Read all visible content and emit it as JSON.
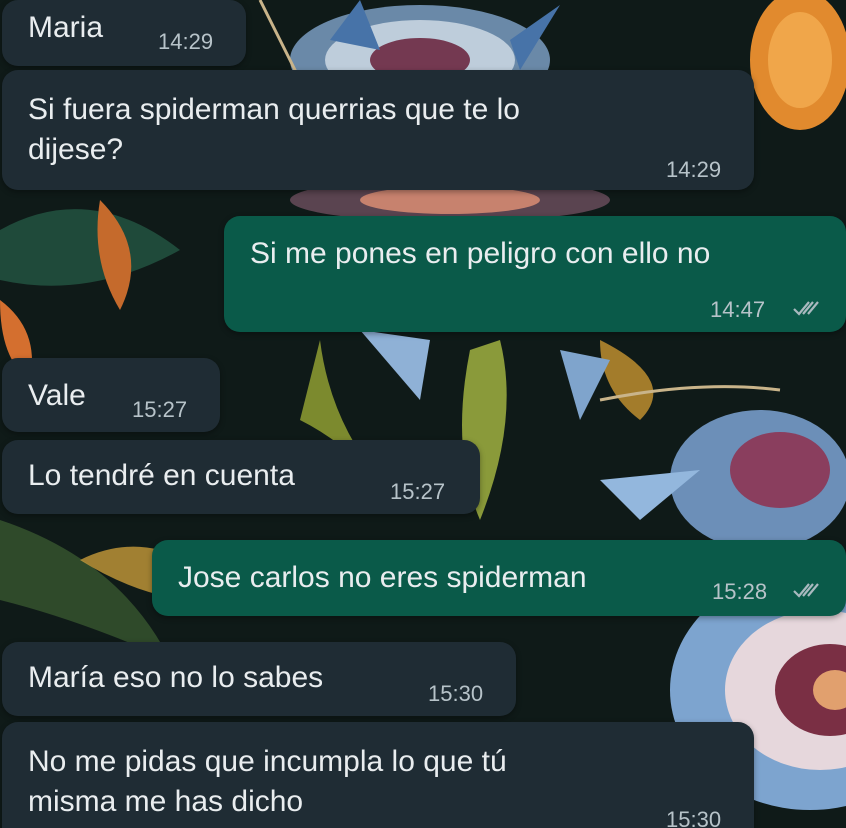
{
  "chat": {
    "messages": [
      {
        "sender": "incoming",
        "text": "Maria",
        "time": "14:29"
      },
      {
        "sender": "incoming",
        "text": "Si fuera spiderman querrias que te lo\ndijese?",
        "time": "14:29"
      },
      {
        "sender": "outgoing",
        "text": "Si me pones en peligro con ello no",
        "time": "14:47",
        "status": "double-check-icon"
      },
      {
        "sender": "incoming",
        "text": "Vale",
        "time": "15:27"
      },
      {
        "sender": "incoming",
        "text": "Lo tendré en cuenta",
        "time": "15:27"
      },
      {
        "sender": "outgoing",
        "text": "Jose carlos no eres spiderman",
        "time": "15:28",
        "status": "double-check-icon"
      },
      {
        "sender": "incoming",
        "text": "María eso no lo sabes",
        "time": "15:30"
      },
      {
        "sender": "incoming",
        "text": "No me pidas que incumpla lo que tú\nmisma me has dicho",
        "time": "15:30"
      }
    ]
  },
  "colors": {
    "incoming_bubble": "#1f2c34",
    "outgoing_bubble": "#0a5a49",
    "text": "#e9edef",
    "time": "#b7c3c9",
    "wallpaper_base": "#0f1a18"
  }
}
